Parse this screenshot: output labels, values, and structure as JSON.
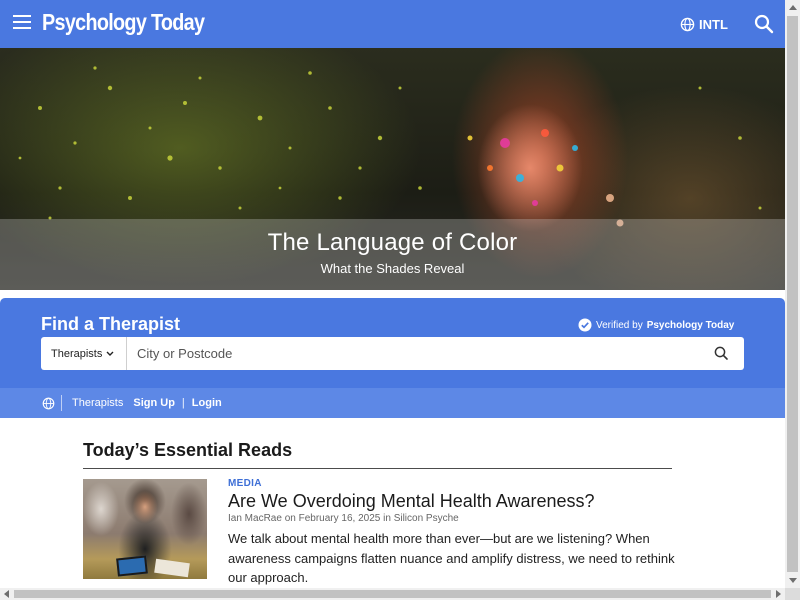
{
  "header": {
    "logo": "Psychology Today",
    "region_label": "INTL",
    "icons": {
      "menu": "hamburger-menu-icon",
      "region": "globe-icon",
      "search": "search-icon"
    },
    "background_color": "#4a78e0"
  },
  "hero": {
    "title": "The Language of Color",
    "subtitle": "What the Shades Reveal"
  },
  "finder": {
    "title": "Find a Therapist",
    "verified_prefix": "Verified by",
    "verified_brand": "Psychology Today",
    "type_select": {
      "selected": "Therapists"
    },
    "city_input": {
      "placeholder": "City or Postcode",
      "value": ""
    },
    "nav": {
      "therapists": "Therapists",
      "sign_up": "Sign Up",
      "separator": "|",
      "login": "Login"
    }
  },
  "reads": {
    "heading": "Today’s Essential Reads",
    "articles": [
      {
        "category": "MEDIA",
        "title": "Are We Overdoing Mental Health Awareness?",
        "author": "Ian MacRae",
        "date_prefix": "on",
        "date": "February 16, 2025",
        "blog_prefix": "in",
        "blog": "Silicon Psyche",
        "summary": "We talk about mental health more than ever—but are we listening? When awareness campaigns flatten nuance and amplify distress, we need to rethink our approach."
      }
    ]
  },
  "colors": {
    "brand_blue": "#4a78e0",
    "nav_blue": "#5d88e6",
    "category_blue": "#3e6fd6"
  }
}
